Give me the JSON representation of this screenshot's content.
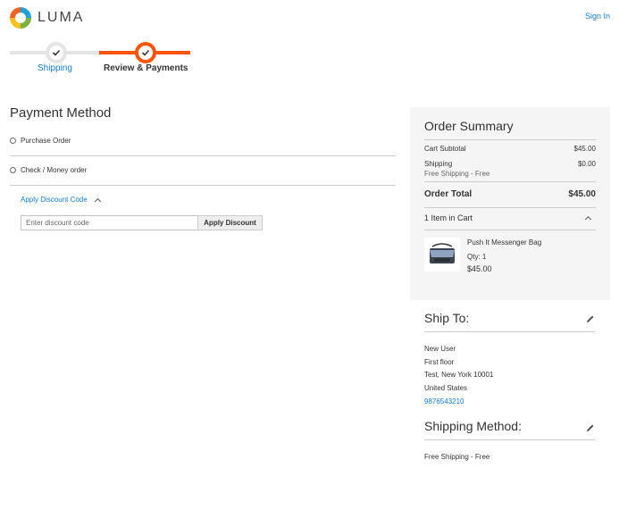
{
  "header": {
    "logo_text": "LUMA",
    "sign_in": "Sign In"
  },
  "progress": {
    "steps": [
      {
        "label": "Shipping",
        "state": "complete"
      },
      {
        "label": "Review & Payments",
        "state": "active"
      }
    ]
  },
  "payment": {
    "title": "Payment Method",
    "options": [
      "Purchase Order",
      "Check / Money order"
    ],
    "discount": {
      "toggle_label": "Apply Discount Code",
      "placeholder": "Enter discount code",
      "button_label": "Apply Discount"
    }
  },
  "summary": {
    "title": "Order Summary",
    "cart_subtotal_label": "Cart Subtotal",
    "cart_subtotal": "$45.00",
    "shipping_label": "Shipping",
    "shipping_method_note": "Free Shipping - Free",
    "shipping_value": "$0.00",
    "order_total_label": "Order Total",
    "order_total": "$45.00",
    "items_header": "1 Item in Cart",
    "item": {
      "name": "Push It Messenger Bag",
      "qty": "Qty: 1",
      "price": "$45.00"
    }
  },
  "ship_to": {
    "title": "Ship To:",
    "lines": [
      "New User",
      "First floor",
      "Test, New York 10001",
      "United States"
    ],
    "phone": "9876543210"
  },
  "shipping_method": {
    "title": "Shipping Method:",
    "value": "Free Shipping - Free"
  },
  "colors": {
    "accent_orange": "#ff5501",
    "link_blue": "#1979c3",
    "summary_bg": "#f5f5f5"
  }
}
